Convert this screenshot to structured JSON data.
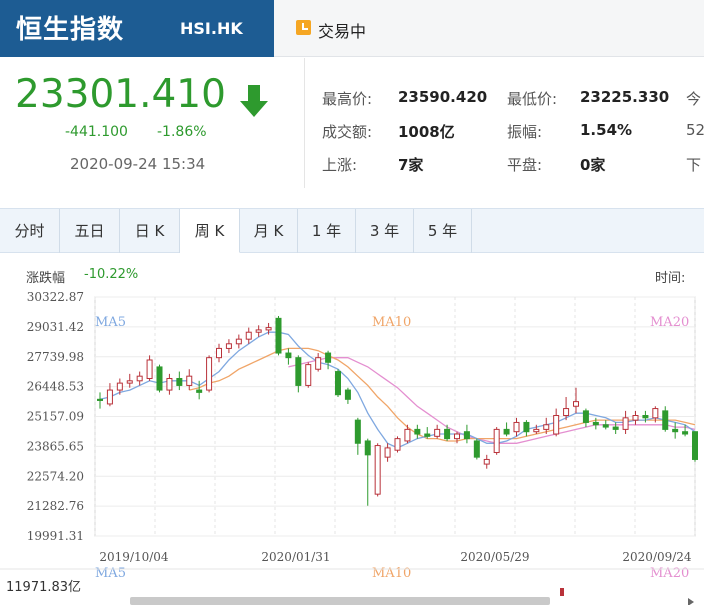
{
  "header": {
    "index_name": "恒生指数",
    "index_code": "HSI.HK",
    "status": "交易中"
  },
  "quote": {
    "price": "23301.410",
    "change": "-441.100",
    "change_pct": "-1.86%",
    "timestamp": "2020-09-24 15:34",
    "stats": [
      {
        "label": "最高价:",
        "value": "23590.420"
      },
      {
        "label": "最低价:",
        "value": "23225.330"
      },
      {
        "label": "今",
        "value": ""
      },
      {
        "label": "成交额:",
        "value": "1008亿"
      },
      {
        "label": "振幅:",
        "value": "1.54%"
      },
      {
        "label": "",
        "value": "52"
      },
      {
        "label": "上涨:",
        "value": "7家"
      },
      {
        "label": "平盘:",
        "value": "0家"
      },
      {
        "label": "下",
        "value": ""
      }
    ]
  },
  "tabs": [
    "分时",
    "五日",
    "日 K",
    "周 K",
    "月 K",
    "1 年",
    "3 年",
    "5 年"
  ],
  "active_tab": 3,
  "chart_panel": {
    "chg_label": "涨跌幅",
    "chg_value": "-10.22%",
    "time_label": "时间:",
    "vol_label": "11971.83亿"
  },
  "colors": {
    "up": "#b9323a",
    "down": "#2e9a2e",
    "ma5": "#7fa8e0",
    "ma10": "#f0a568",
    "ma20": "#e48fd0",
    "header_blue": "#1d5c93"
  },
  "chart_data": {
    "type": "candlestick",
    "y_ticks": [
      "30322.87",
      "29031.42",
      "27739.98",
      "26448.53",
      "25157.09",
      "23865.65",
      "22574.20",
      "21282.76",
      "19991.31"
    ],
    "ylim": [
      19991.31,
      30322.87
    ],
    "x_labels": [
      "2019/10/04",
      "2020/01/31",
      "2020/05/29",
      "2020/09/24"
    ],
    "legend": [
      "MA5",
      "MA10",
      "MA20"
    ],
    "candles": [
      {
        "o": 25900,
        "c": 25850,
        "h": 26200,
        "l": 25500
      },
      {
        "o": 25700,
        "c": 26300,
        "h": 26600,
        "l": 25600
      },
      {
        "o": 26300,
        "c": 26600,
        "h": 26800,
        "l": 26100
      },
      {
        "o": 26600,
        "c": 26700,
        "h": 27000,
        "l": 26400
      },
      {
        "o": 26700,
        "c": 26900,
        "h": 27100,
        "l": 26500
      },
      {
        "o": 26800,
        "c": 27600,
        "h": 27800,
        "l": 26700
      },
      {
        "o": 27300,
        "c": 26300,
        "h": 27400,
        "l": 26200
      },
      {
        "o": 26300,
        "c": 26800,
        "h": 27000,
        "l": 26100
      },
      {
        "o": 26800,
        "c": 26500,
        "h": 27100,
        "l": 26300
      },
      {
        "o": 26500,
        "c": 26900,
        "h": 27200,
        "l": 26300
      },
      {
        "o": 26300,
        "c": 26200,
        "h": 26700,
        "l": 25900
      },
      {
        "o": 26300,
        "c": 27700,
        "h": 27800,
        "l": 26200
      },
      {
        "o": 27700,
        "c": 28100,
        "h": 28300,
        "l": 27500
      },
      {
        "o": 28100,
        "c": 28300,
        "h": 28500,
        "l": 27900
      },
      {
        "o": 28300,
        "c": 28500,
        "h": 28700,
        "l": 28100
      },
      {
        "o": 28500,
        "c": 28800,
        "h": 29000,
        "l": 28300
      },
      {
        "o": 28800,
        "c": 28900,
        "h": 29100,
        "l": 28600
      },
      {
        "o": 28900,
        "c": 29000,
        "h": 29200,
        "l": 28700
      },
      {
        "o": 29400,
        "c": 27900,
        "h": 29500,
        "l": 27800
      },
      {
        "o": 27900,
        "c": 27700,
        "h": 28100,
        "l": 27400
      },
      {
        "o": 27700,
        "c": 26500,
        "h": 27800,
        "l": 26200
      },
      {
        "o": 26500,
        "c": 27400,
        "h": 27500,
        "l": 26400
      },
      {
        "o": 27200,
        "c": 27700,
        "h": 27900,
        "l": 27100
      },
      {
        "o": 27900,
        "c": 27500,
        "h": 28000,
        "l": 27200
      },
      {
        "o": 27100,
        "c": 26100,
        "h": 27200,
        "l": 26000
      },
      {
        "o": 26300,
        "c": 25900,
        "h": 26400,
        "l": 25700
      },
      {
        "o": 25000,
        "c": 24000,
        "h": 25100,
        "l": 23500
      },
      {
        "o": 24100,
        "c": 23500,
        "h": 24200,
        "l": 21300
      },
      {
        "o": 21800,
        "c": 23900,
        "h": 24000,
        "l": 21700
      },
      {
        "o": 23400,
        "c": 23800,
        "h": 24000,
        "l": 23200
      },
      {
        "o": 23700,
        "c": 24200,
        "h": 24300,
        "l": 23600
      },
      {
        "o": 24100,
        "c": 24600,
        "h": 24800,
        "l": 24000
      },
      {
        "o": 24600,
        "c": 24400,
        "h": 24800,
        "l": 24200
      },
      {
        "o": 24400,
        "c": 24300,
        "h": 24700,
        "l": 24200
      },
      {
        "o": 24300,
        "c": 24600,
        "h": 24800,
        "l": 24200
      },
      {
        "o": 24600,
        "c": 24200,
        "h": 24800,
        "l": 24100
      },
      {
        "o": 24200,
        "c": 24400,
        "h": 24500,
        "l": 24000
      },
      {
        "o": 24500,
        "c": 24200,
        "h": 24800,
        "l": 24000
      },
      {
        "o": 24100,
        "c": 23400,
        "h": 24200,
        "l": 23300
      },
      {
        "o": 23100,
        "c": 23300,
        "h": 23500,
        "l": 22900
      },
      {
        "o": 23600,
        "c": 24600,
        "h": 24700,
        "l": 23500
      },
      {
        "o": 24600,
        "c": 24400,
        "h": 24900,
        "l": 24300
      },
      {
        "o": 24500,
        "c": 24900,
        "h": 25100,
        "l": 24300
      },
      {
        "o": 24900,
        "c": 24500,
        "h": 25000,
        "l": 24300
      },
      {
        "o": 24500,
        "c": 24600,
        "h": 24800,
        "l": 24400
      },
      {
        "o": 24600,
        "c": 24800,
        "h": 25100,
        "l": 24400
      },
      {
        "o": 24400,
        "c": 25200,
        "h": 25500,
        "l": 24300
      },
      {
        "o": 25200,
        "c": 25500,
        "h": 26000,
        "l": 25000
      },
      {
        "o": 25600,
        "c": 25800,
        "h": 26400,
        "l": 25300
      },
      {
        "o": 25400,
        "c": 24900,
        "h": 25500,
        "l": 24700
      },
      {
        "o": 24900,
        "c": 24800,
        "h": 25100,
        "l": 24600
      },
      {
        "o": 24800,
        "c": 24700,
        "h": 25000,
        "l": 24600
      },
      {
        "o": 24700,
        "c": 24600,
        "h": 24900,
        "l": 24400
      },
      {
        "o": 24600,
        "c": 25100,
        "h": 25400,
        "l": 24400
      },
      {
        "o": 25000,
        "c": 25200,
        "h": 25400,
        "l": 24800
      },
      {
        "o": 25200,
        "c": 25100,
        "h": 25400,
        "l": 24900
      },
      {
        "o": 25100,
        "c": 25500,
        "h": 25600,
        "l": 24900
      },
      {
        "o": 25400,
        "c": 24600,
        "h": 25600,
        "l": 24500
      },
      {
        "o": 24600,
        "c": 24500,
        "h": 24900,
        "l": 24200
      },
      {
        "o": 24500,
        "c": 24400,
        "h": 24800,
        "l": 24300
      },
      {
        "o": 24500,
        "c": 23300,
        "h": 24500,
        "l": 23200
      }
    ],
    "ma5": [
      25900,
      26000,
      26200,
      26300,
      26500,
      26700,
      26600,
      26700,
      26700,
      26700,
      26500,
      26800,
      27100,
      27600,
      28000,
      28300,
      28600,
      28800,
      28800,
      28700,
      28200,
      27800,
      27500,
      27400,
      27200,
      26800,
      26200,
      25300,
      24600,
      24000,
      23800,
      24000,
      24200,
      24300,
      24400,
      24400,
      24400,
      24400,
      24200,
      24000,
      24000,
      24100,
      24300,
      24600,
      24700,
      24800,
      24900,
      25100,
      25300,
      25300,
      25200,
      25100,
      24900,
      24900,
      25000,
      25000,
      25100,
      25000,
      24900,
      24800,
      24500
    ],
    "ma10": [
      null,
      null,
      null,
      null,
      null,
      null,
      null,
      null,
      null,
      26300,
      26400,
      26600,
      26700,
      26900,
      27200,
      27400,
      27600,
      27800,
      28000,
      28100,
      28100,
      28100,
      28000,
      27800,
      27600,
      27300,
      26900,
      26500,
      26000,
      25600,
      25100,
      24700,
      24400,
      24200,
      24200,
      24100,
      24100,
      24200,
      24200,
      24200,
      24200,
      24200,
      24200,
      24300,
      24400,
      24500,
      24600,
      24700,
      24800,
      24900,
      25000,
      25000,
      25000,
      25000,
      25000,
      25000,
      25000,
      25000,
      25000,
      24900,
      24800
    ],
    "ma20": [
      null,
      null,
      null,
      null,
      null,
      null,
      null,
      null,
      null,
      null,
      null,
      null,
      null,
      null,
      null,
      null,
      null,
      null,
      null,
      27300,
      27400,
      27500,
      27600,
      27700,
      27700,
      27700,
      27500,
      27300,
      27000,
      26700,
      26400,
      26000,
      25600,
      25300,
      25000,
      24700,
      24500,
      24300,
      24200,
      24100,
      24000,
      24000,
      24000,
      24100,
      24200,
      24300,
      24400,
      24500,
      24600,
      24700,
      24800,
      24800,
      24800,
      24800,
      24800,
      24800,
      24800,
      24800,
      24700,
      24700,
      24600
    ]
  }
}
